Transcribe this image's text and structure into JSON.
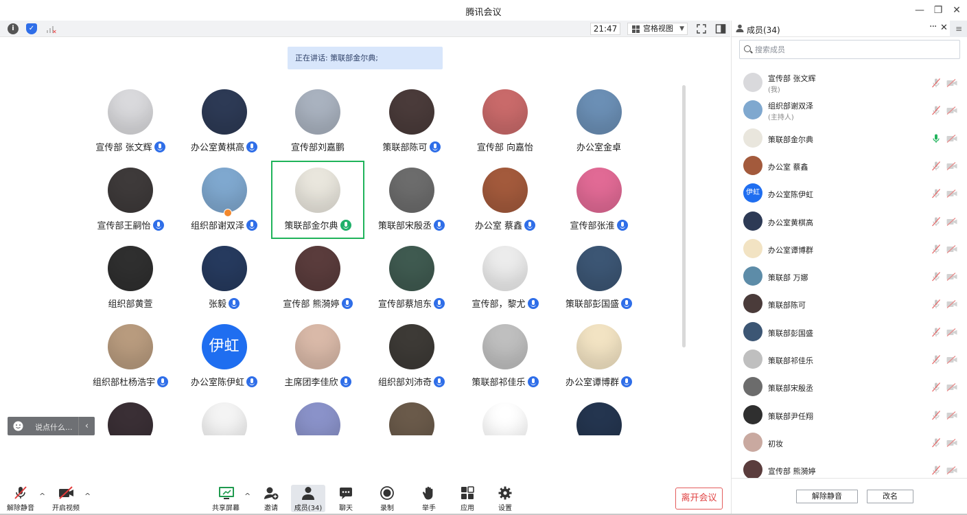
{
  "window": {
    "title": "腾讯会议",
    "minimize": "—",
    "restore": "❐",
    "close": "✕"
  },
  "toolbar": {
    "time": "21:47",
    "view_mode": "宫格视图"
  },
  "speaking": {
    "text": "正在讲话: 策联部金尔典;"
  },
  "grid": {
    "tiles": [
      {
        "name": "宣传部 张文辉",
        "mic": true,
        "color": "#d9d9dc"
      },
      {
        "name": "办公室黄棋高",
        "mic": true,
        "color": "#2d3a55"
      },
      {
        "name": "宣传部刘嘉鹏",
        "mic": false,
        "color": "#a9b2bf"
      },
      {
        "name": "策联部陈可",
        "mic": true,
        "color": "#4a3b3a"
      },
      {
        "name": "宣传部 向嘉怡",
        "mic": false,
        "color": "#c96a6a"
      },
      {
        "name": "办公室金卓",
        "mic": false,
        "color": "#6b8fb5"
      },
      {
        "name": "宣传部王嗣怡",
        "mic": true,
        "color": "#3e3a3a"
      },
      {
        "name": "组织部谢双泽",
        "mic": true,
        "color": "#7fa8cf",
        "host": true
      },
      {
        "name": "策联部金尔典",
        "mic": true,
        "speaking": true,
        "color": "#e9e6dd"
      },
      {
        "name": "策联部宋殷丞",
        "mic": true,
        "color": "#6c6c6c"
      },
      {
        "name": "办公室 蔡鑫",
        "mic": true,
        "color": "#a35a3c"
      },
      {
        "name": "宣传部张淮",
        "mic": true,
        "color": "#e16a95"
      },
      {
        "name": "组织部黄萱",
        "mic": false,
        "color": "#2f2f2f"
      },
      {
        "name": "张毅",
        "mic": true,
        "color": "#263a5e"
      },
      {
        "name": "宣传部 熊漪婷",
        "mic": true,
        "color": "#5a3c3c"
      },
      {
        "name": "宣传部蔡旭东",
        "mic": true,
        "color": "#3f5a50"
      },
      {
        "name": "宣传部，黎尤",
        "mic": true,
        "color": "#ececec"
      },
      {
        "name": "策联部彭国盛",
        "mic": true,
        "color": "#3c5674"
      },
      {
        "name": "组织部杜杨浩宇",
        "mic": true,
        "color": "#b89b7e"
      },
      {
        "name": "办公室陈伊虹",
        "mic": true,
        "color": "#1f6ef0",
        "initials": "伊虹"
      },
      {
        "name": "主席团李佳欣",
        "mic": true,
        "color": "#d9b9a8"
      },
      {
        "name": "组织部刘沛奇",
        "mic": true,
        "color": "#3d3a36"
      },
      {
        "name": "策联部祁佳乐",
        "mic": true,
        "color": "#bfbfbf"
      },
      {
        "name": "办公室谭博群",
        "mic": true,
        "color": "#f2e3c3"
      },
      {
        "name": "",
        "mic": false,
        "color": "#3a2f35"
      },
      {
        "name": "",
        "mic": false,
        "color": "#f4f4f4"
      },
      {
        "name": "",
        "mic": false,
        "color": "#8a92c9"
      },
      {
        "name": "",
        "mic": false,
        "color": "#6a5a4a"
      },
      {
        "name": "",
        "mic": false,
        "color": "#ffffff"
      },
      {
        "name": "",
        "mic": false,
        "color": "#24354f"
      }
    ]
  },
  "chat": {
    "placeholder": "说点什么..."
  },
  "bottombar": {
    "unmute": "解除静音",
    "video": "开启视频",
    "share": "共享屏幕",
    "invite": "邀请",
    "members": "成员(34)",
    "chat": "聊天",
    "record": "录制",
    "raise_hand": "举手",
    "apps": "应用",
    "settings": "设置",
    "leave": "离开会议"
  },
  "panel": {
    "title": "成员(34)",
    "search_placeholder": "搜索成员",
    "members": [
      {
        "name": "宣传部 张文辉",
        "role": "(我)",
        "color": "#d9d9dc"
      },
      {
        "name": "组织部谢双泽",
        "role": "(主持人)",
        "color": "#7fa8cf"
      },
      {
        "name": "策联部金尔典",
        "role": "",
        "color": "#e9e6dd",
        "speaking": true
      },
      {
        "name": "办公室 蔡鑫",
        "role": "",
        "color": "#a35a3c"
      },
      {
        "name": "办公室陈伊虹",
        "role": "",
        "color": "#1f6ef0",
        "initials": "伊虹"
      },
      {
        "name": "办公室黄棋高",
        "role": "",
        "color": "#2d3a55"
      },
      {
        "name": "办公室谭博群",
        "role": "",
        "color": "#f2e3c3"
      },
      {
        "name": "策联部 万娜",
        "role": "",
        "color": "#5d8ca8"
      },
      {
        "name": "策联部陈可",
        "role": "",
        "color": "#4a3b3a"
      },
      {
        "name": "策联部彭国盛",
        "role": "",
        "color": "#3c5674"
      },
      {
        "name": "策联部祁佳乐",
        "role": "",
        "color": "#bfbfbf"
      },
      {
        "name": "策联部宋殷丞",
        "role": "",
        "color": "#6c6c6c"
      },
      {
        "name": "策联部尹任翔",
        "role": "",
        "color": "#2f2f2f"
      },
      {
        "name": "初妆",
        "role": "",
        "color": "#c9a9a0"
      },
      {
        "name": "宣传部 熊漪婷",
        "role": "",
        "color": "#5a3c3c"
      }
    ],
    "unmute_all": "解除静音",
    "rename": "改名"
  }
}
